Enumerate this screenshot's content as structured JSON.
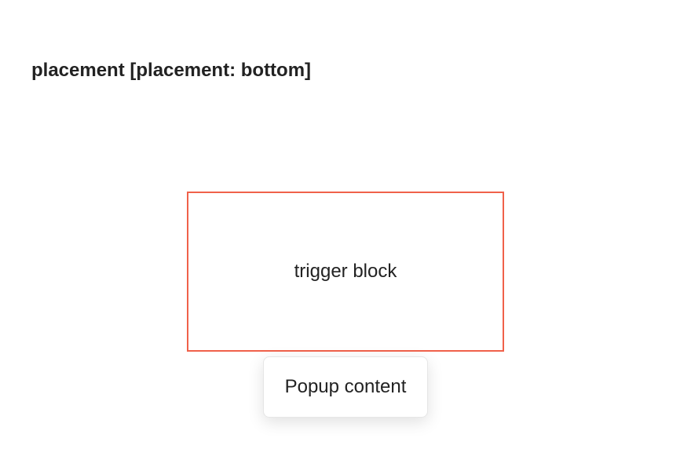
{
  "header": {
    "title": "placement [placement: bottom]"
  },
  "trigger": {
    "label": "trigger block",
    "border_color": "#f0614a"
  },
  "popup": {
    "content": "Popup content"
  }
}
